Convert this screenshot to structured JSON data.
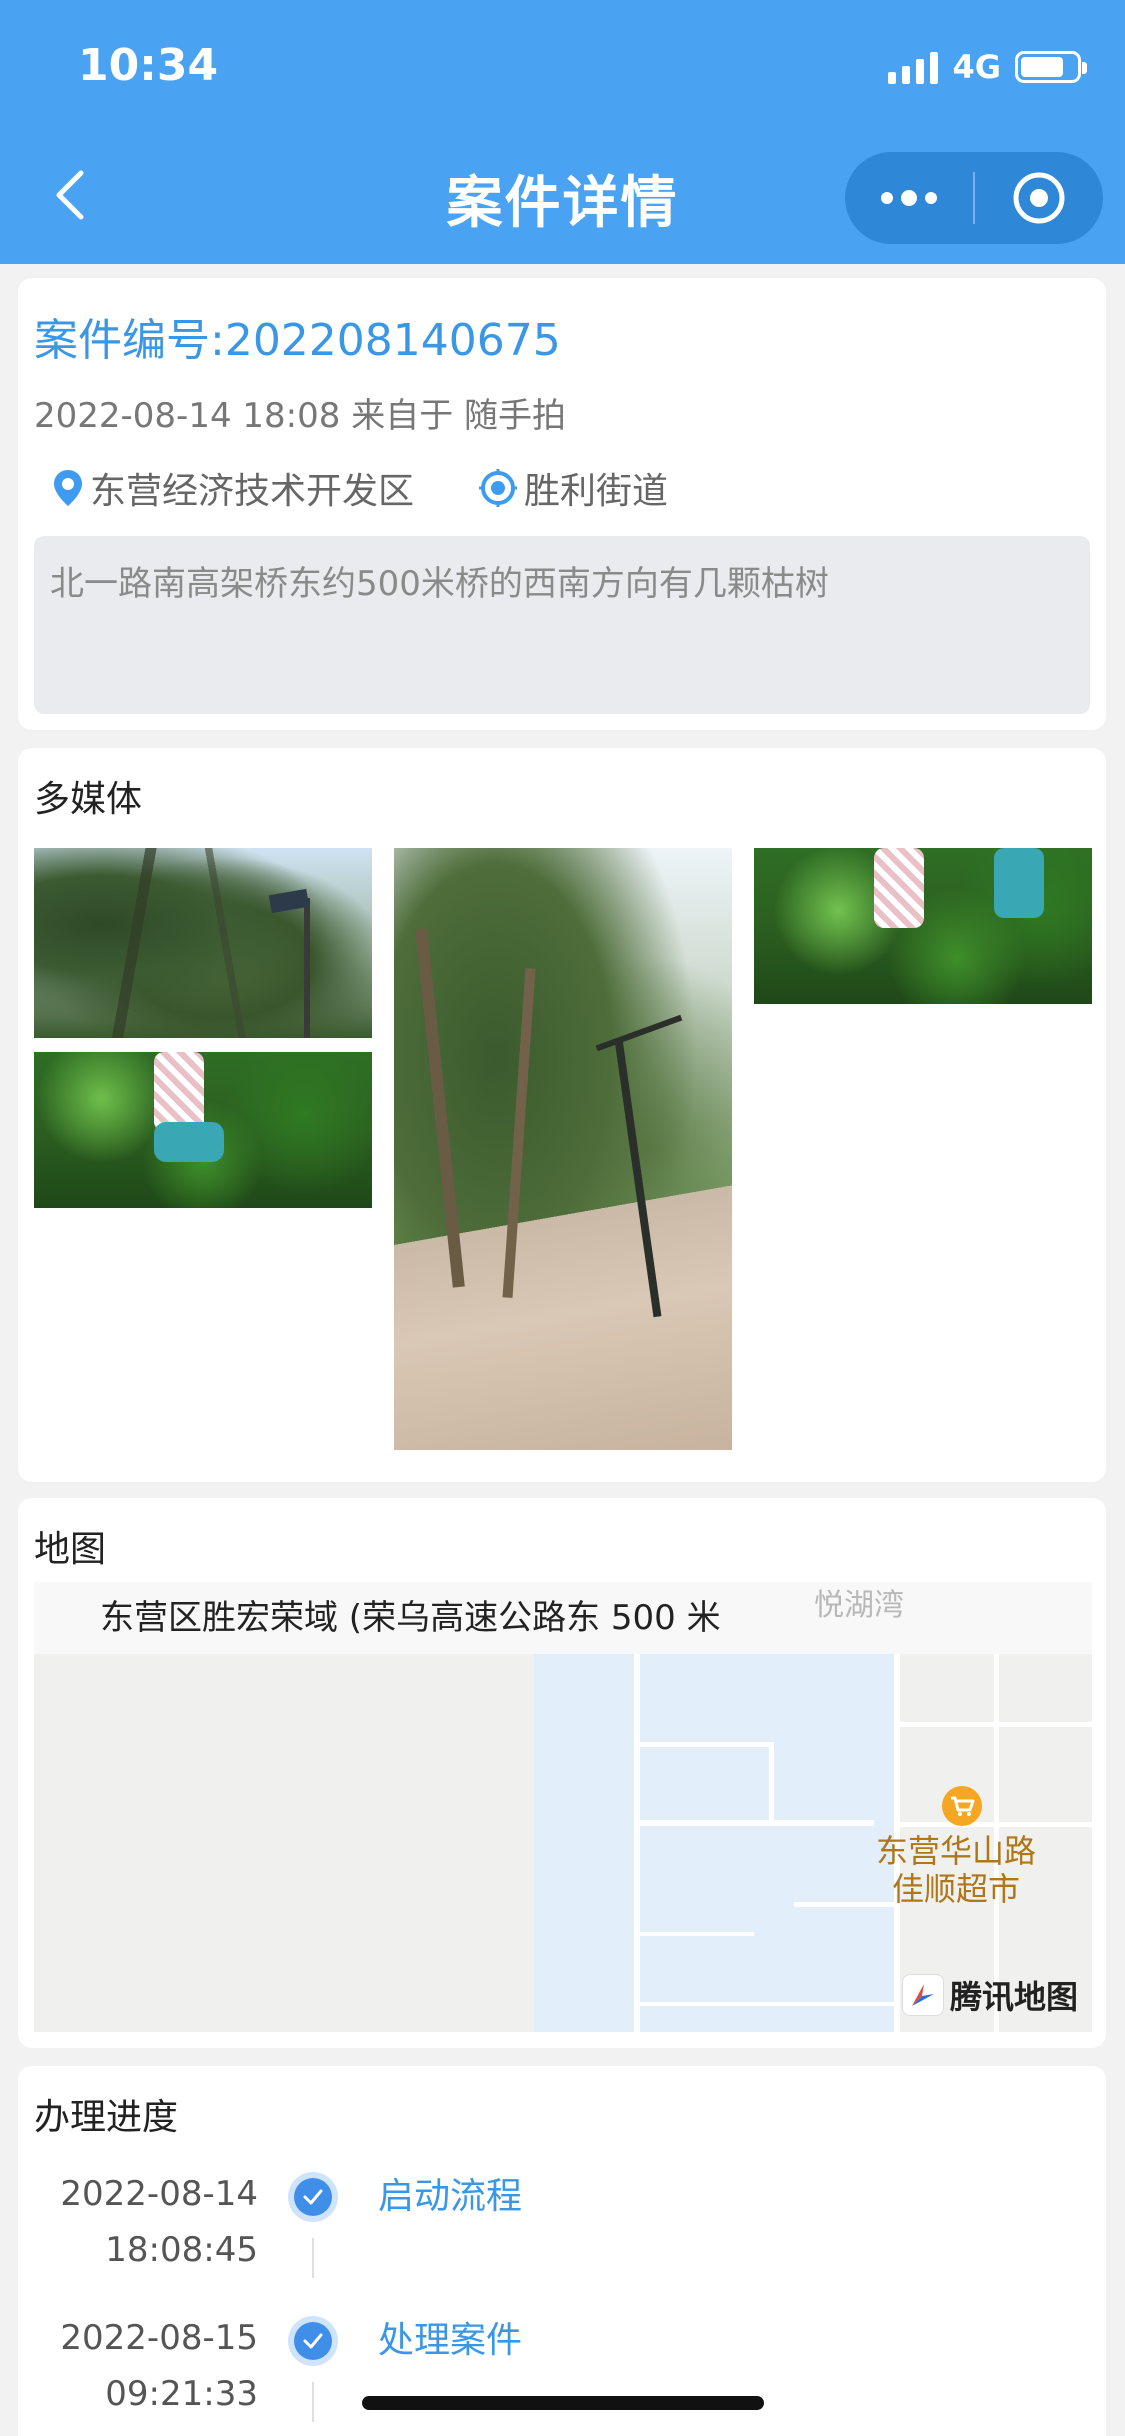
{
  "status_bar": {
    "time": "10:34",
    "network": "4G"
  },
  "nav": {
    "title": "案件详情"
  },
  "case": {
    "number": "案件编号:202208140675",
    "meta": "2022-08-14 18:08 来自于 随手拍",
    "district": "东营经济技术开发区",
    "street": "胜利街道",
    "description": "北一路南高架桥东约500米桥的西南方向有几颗枯树"
  },
  "media": {
    "title": "多媒体"
  },
  "map": {
    "title": "地图",
    "address": "东营区胜宏荣域 (荣乌高速公路东 500 米",
    "poi_top": "悦湖湾",
    "poi_market_line1": "东营华山路",
    "poi_market_line2": "佳顺超市",
    "provider": "腾讯地图"
  },
  "progress": {
    "title": "办理进度",
    "steps": [
      {
        "date": "2022-08-14",
        "time": "18:08:45",
        "label": "启动流程"
      },
      {
        "date": "2022-08-15",
        "time": "09:21:33",
        "label": "处理案件"
      }
    ]
  },
  "colors": {
    "primary": "#4aa3f2",
    "accent": "#3a97e6",
    "background": "#f2f2f2"
  }
}
